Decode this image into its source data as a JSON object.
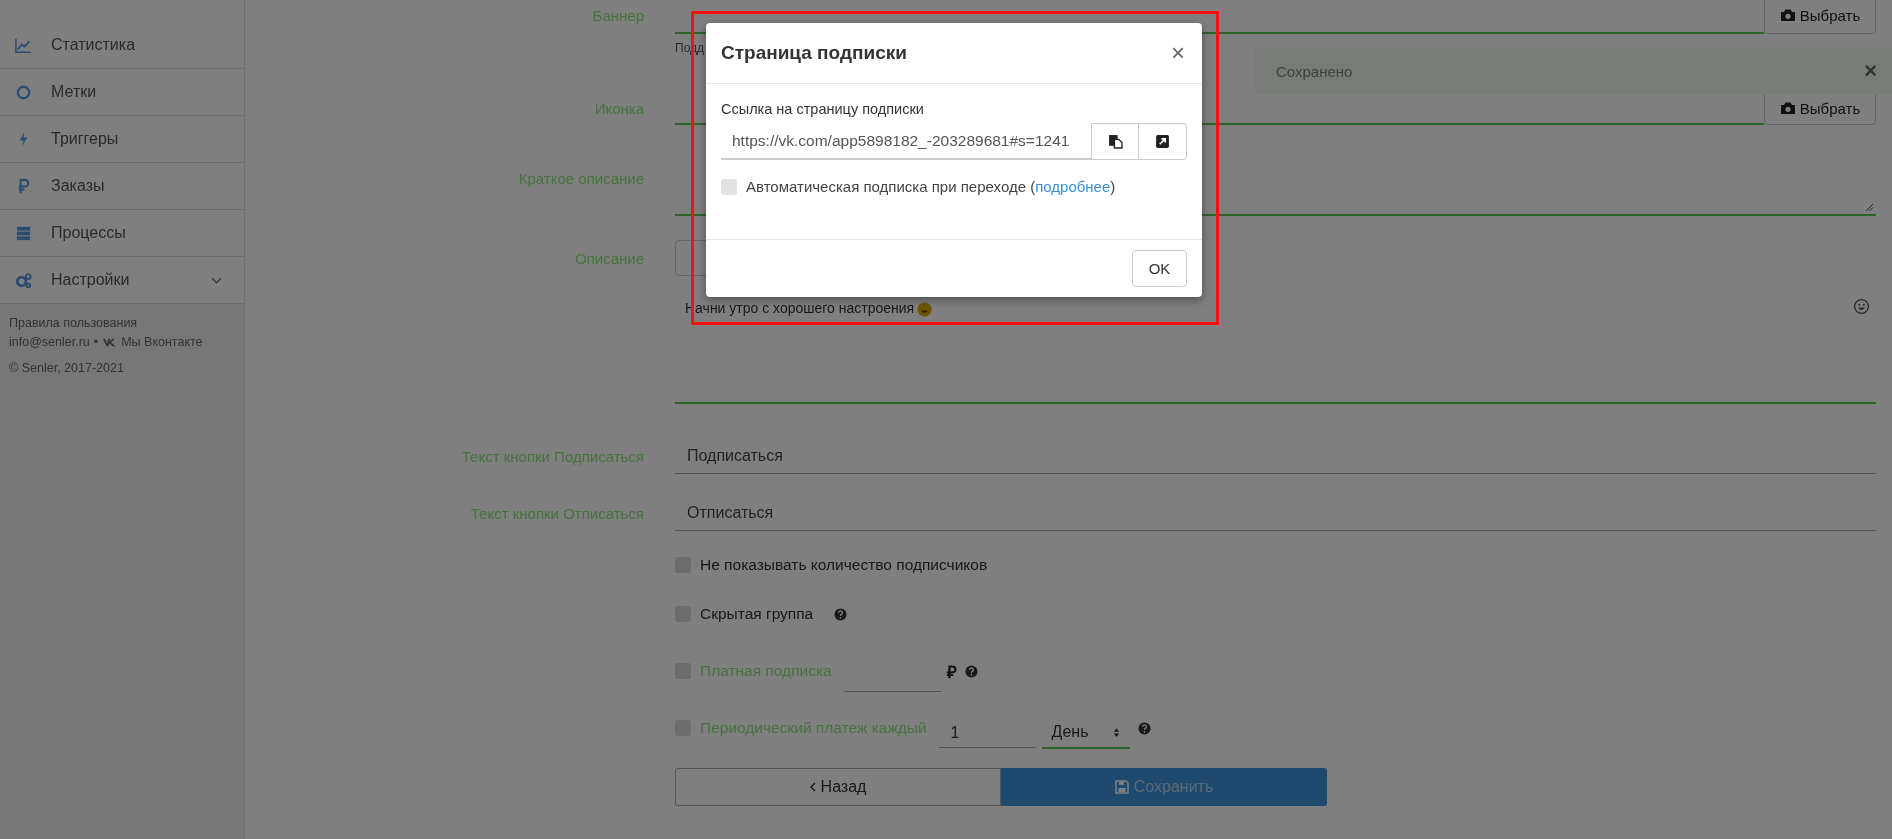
{
  "sidebar": {
    "items": [
      {
        "label": "Статистика",
        "expandable": false
      },
      {
        "label": "Метки",
        "expandable": false
      },
      {
        "label": "Триггеры",
        "expandable": false
      },
      {
        "label": "Заказы",
        "expandable": false
      },
      {
        "label": "Процессы",
        "expandable": false
      },
      {
        "label": "Настройки",
        "expandable": true
      }
    ],
    "footer": {
      "terms_link": "Правила пользования",
      "email": "info@senler.ru",
      "separator": "•",
      "vk_link": "Мы Вконтакте",
      "copyright": "© Senler, 2017-2021"
    }
  },
  "form": {
    "banner": {
      "label": "Баннер",
      "button": "Выбрать",
      "hint": "Подд"
    },
    "icon": {
      "label": "Иконка",
      "button": "Выбрать"
    },
    "short_description": {
      "label": "Краткое описание"
    },
    "description": {
      "label": "Описание",
      "text": "Начни утро с хорошего настроения"
    },
    "subscribe_text": {
      "label": "Текст кнопки Подписаться",
      "value": "Подписаться"
    },
    "unsubscribe_text": {
      "label": "Текст кнопки Отписаться",
      "value": "Отписаться"
    },
    "options": [
      {
        "kind": "plain",
        "label": "Не показывать количество подписчиков",
        "checked": false
      },
      {
        "kind": "help",
        "label": "Скрытая группа",
        "checked": false
      },
      {
        "kind": "price",
        "label": "Платная подписка",
        "checked": false,
        "currency": "₽"
      },
      {
        "kind": "period",
        "label": "Периодический платеж каждый",
        "checked": false,
        "value": "1",
        "unit": "День"
      }
    ],
    "back_button": "Назад",
    "save_button": "Сохранить"
  },
  "toast": {
    "text": "Сохранено",
    "close": "×"
  },
  "modal": {
    "title": "Страница подписки",
    "close": "×",
    "link_label": "Ссылка на страницу подписки",
    "link_value": "https://vk.com/app5898182_-203289681#s=1241",
    "auto_subscribe": {
      "checked": false,
      "text_before": "Автоматическая подписка при переходе (",
      "link": "подробнее",
      "text_after": ")"
    },
    "ok_button": "OK"
  }
}
